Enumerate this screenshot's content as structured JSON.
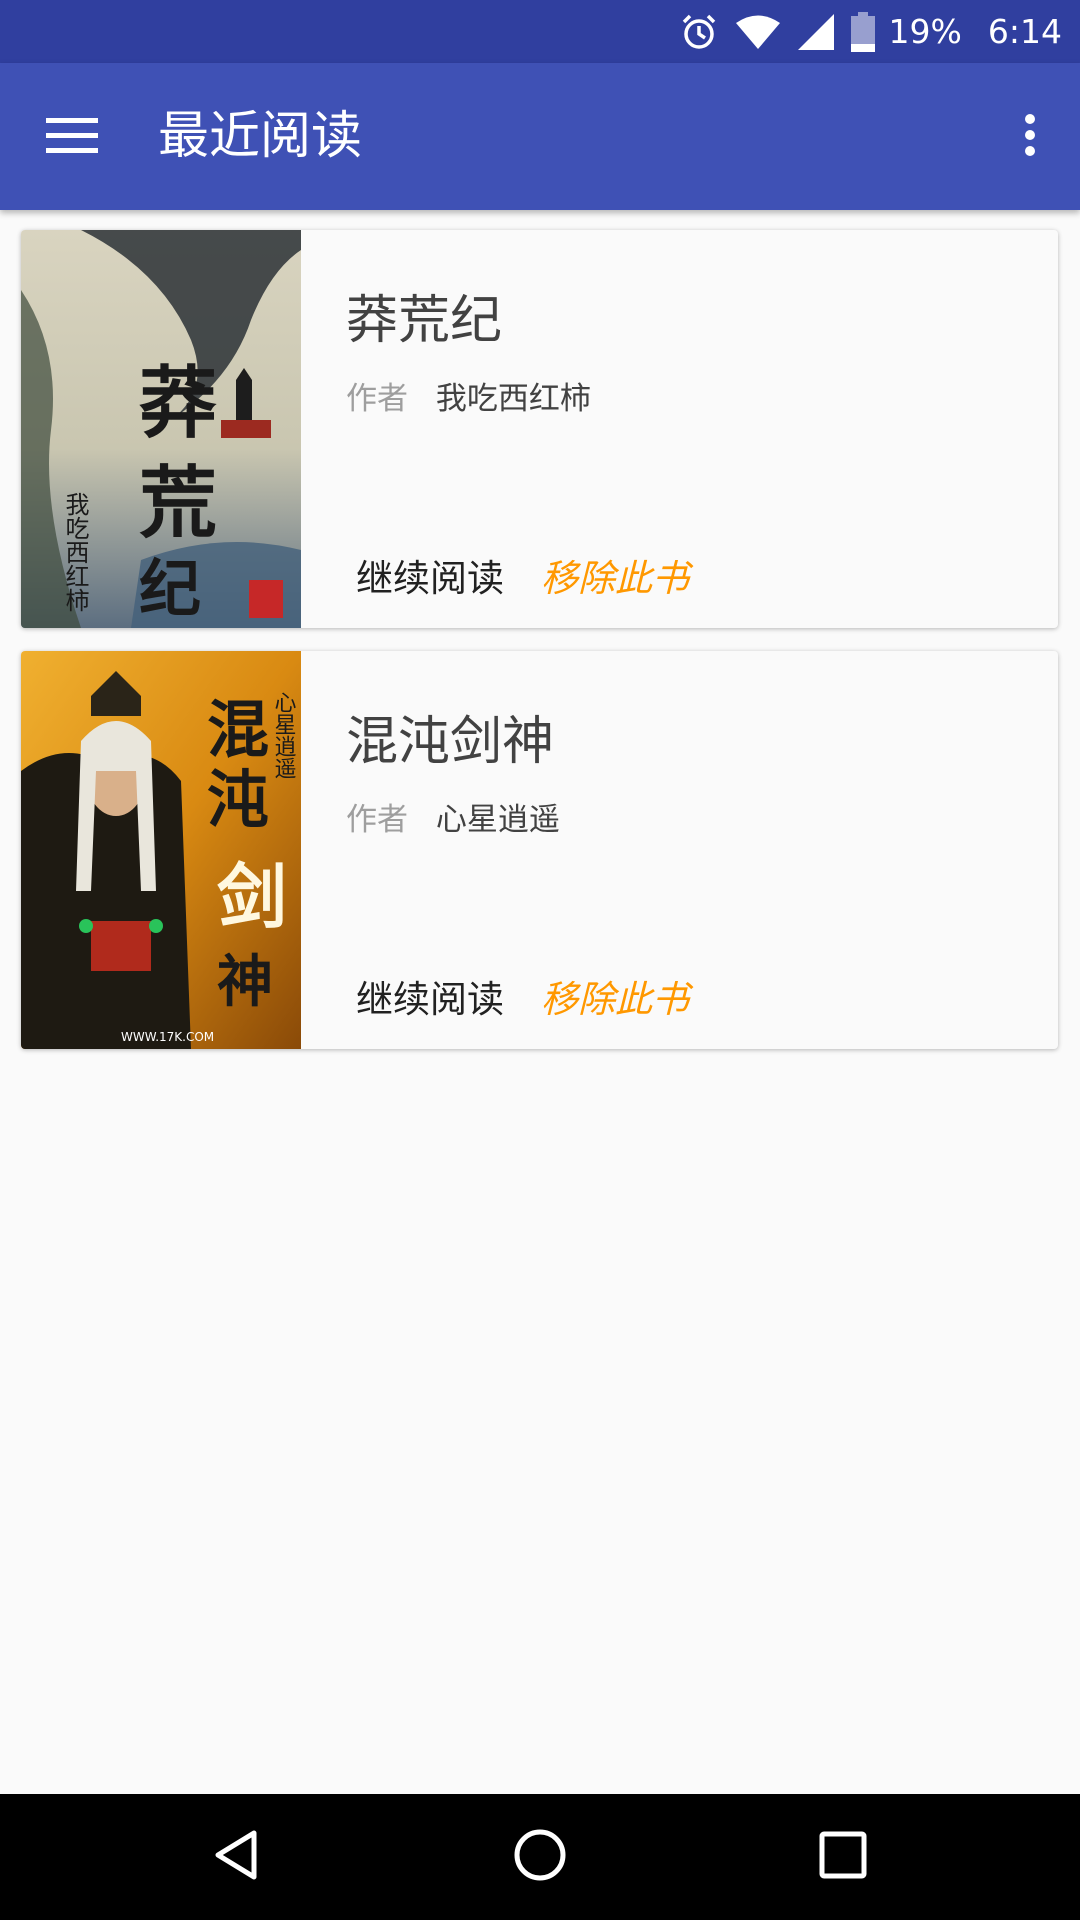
{
  "status_bar": {
    "battery_percent": "19%",
    "time": "6:14",
    "icons": [
      "alarm-icon",
      "wifi-icon",
      "signal-icon",
      "battery-icon"
    ]
  },
  "app_bar": {
    "title": "最近阅读",
    "menu_icon": "menu-icon",
    "more_icon": "more-vert-icon"
  },
  "books": [
    {
      "title": "莽荒纪",
      "author_label": "作者",
      "author": "我吃西红柿",
      "continue_label": "继续阅读",
      "remove_label": "移除此书",
      "cover_text": "莽荒纪",
      "cover_author": "我吃西红柿"
    },
    {
      "title": "混沌剑神",
      "author_label": "作者",
      "author": "心星逍遥",
      "continue_label": "继续阅读",
      "remove_label": "移除此书",
      "cover_text": "混沌剑神",
      "cover_author": "心星逍遥",
      "cover_url": "WWW.17K.COM"
    }
  ],
  "nav_bar": {
    "back_icon": "back-icon",
    "home_icon": "home-icon",
    "recents_icon": "recents-icon"
  },
  "colors": {
    "status_bar": "#303f9f",
    "app_bar": "#3f51b5",
    "remove_accent": "#ff9800"
  }
}
